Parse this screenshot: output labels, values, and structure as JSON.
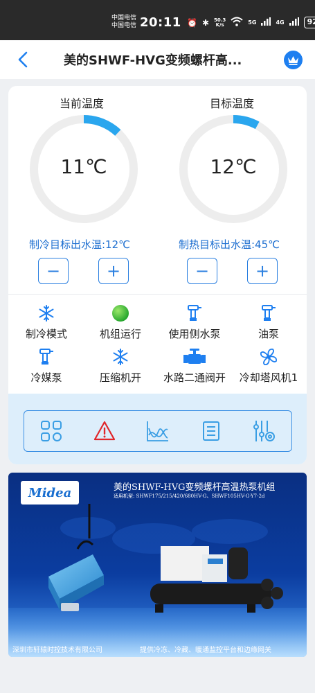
{
  "status_bar": {
    "carrier_1": "中国电信",
    "carrier_2": "中国电信",
    "time": "20:11",
    "speed_value": "50.3",
    "speed_unit": "K/s",
    "net_1": "5G",
    "net_2": "4G",
    "battery": "92"
  },
  "nav": {
    "title": "美的SHWF-HVG变频螺杆高..."
  },
  "gauges": {
    "current": {
      "label": "当前温度",
      "value": "11℃",
      "level": 0.12
    },
    "target": {
      "label": "目标温度",
      "value": "12℃",
      "level": 0.08
    }
  },
  "setpoints": {
    "cooling": "制冷目标出水温:12℃",
    "heating": "制热目标出水温:45℃",
    "minus": "−",
    "plus": "+"
  },
  "status_items": [
    {
      "label": "制冷模式",
      "icon": "snowflake-icon"
    },
    {
      "label": "机组运行",
      "icon": "green-indicator-icon"
    },
    {
      "label": "使用侧水泵",
      "icon": "pump-icon"
    },
    {
      "label": "油泵",
      "icon": "pump-icon"
    },
    {
      "label": "冷媒泵",
      "icon": "pump-icon"
    },
    {
      "label": "压缩机开",
      "icon": "snowflake-icon"
    },
    {
      "label": "水路二通阀开",
      "icon": "valve-icon"
    },
    {
      "label": "冷却塔风机1",
      "icon": "fan-icon"
    }
  ],
  "toolbar": [
    "grid-icon",
    "alarm-icon",
    "chart-icon",
    "list-icon",
    "settings-sliders-icon"
  ],
  "banner": {
    "logo": "Midea",
    "title": "美的SHWF-HVG变频螺杆高温热泵机组",
    "models": "适用机型: SHWF175/215/420/680HV-G、SHWF105HV-G-Y7-2d",
    "company": "深圳市轩辕时控技术有限公司",
    "slogan": "提供冷冻、冷藏、暖通监控平台和边缘网关"
  },
  "colors": {
    "accent": "#1e7ff0",
    "gauge_track": "#ededed",
    "gauge_fill": "#2aa6ee",
    "alarm": "#e0262a",
    "running": "#3cc23c"
  }
}
